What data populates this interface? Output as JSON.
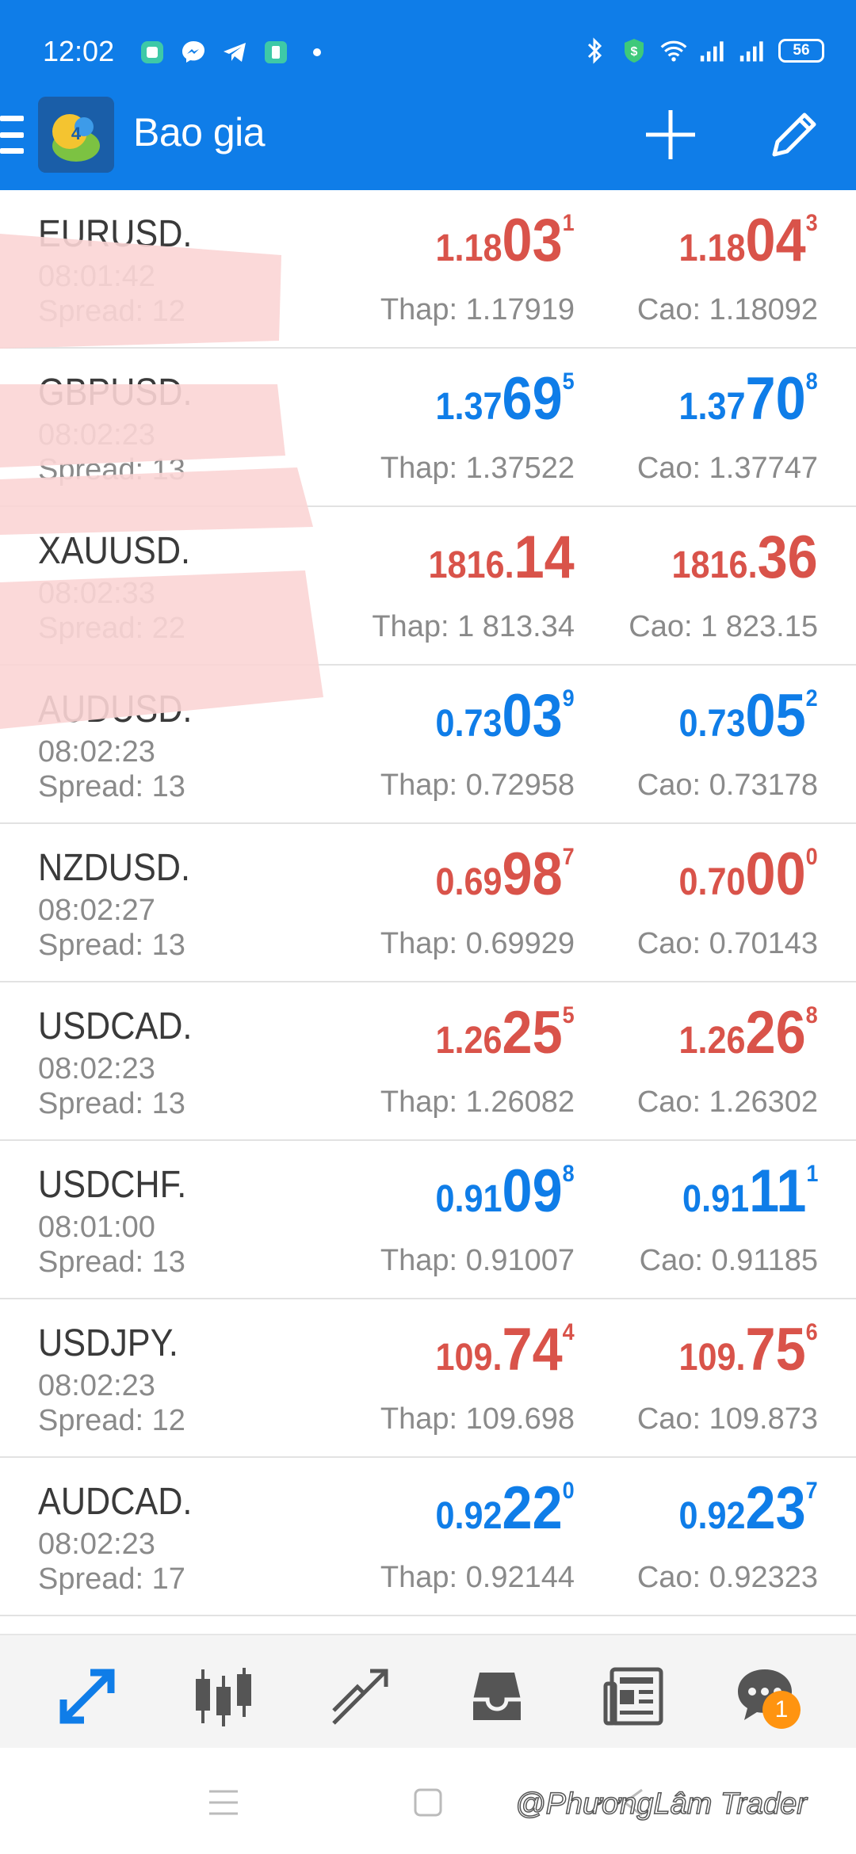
{
  "status_bar": {
    "time": "12:02",
    "battery": "56",
    "left_icons": [
      "app-icon",
      "messenger-icon",
      "telegram-icon",
      "sim-app-icon",
      "dot-icon"
    ],
    "right_icons": [
      "bluetooth-icon",
      "vpn-shield-icon",
      "wifi-icon",
      "signal-icon",
      "signal-icon",
      "battery-icon"
    ]
  },
  "app_bar": {
    "title": "Bao gia",
    "icons": [
      "menu-icon",
      "metatrader-logo",
      "add-icon",
      "edit-icon"
    ]
  },
  "quotes": [
    {
      "symbol": "EURUSD.",
      "time": "08:01:42",
      "spread": "Spread: 12",
      "bid": {
        "small": "1.18",
        "big": "03",
        "sup": "1",
        "color": "#d9534a"
      },
      "ask": {
        "small": "1.18",
        "big": "04",
        "sup": "3",
        "color": "#d9534a"
      },
      "low": "Thap: 1.17919",
      "high": "Cao: 1.18092"
    },
    {
      "symbol": "GBPUSD.",
      "time": "08:02:23",
      "spread": "Spread: 13",
      "bid": {
        "small": "1.37",
        "big": "69",
        "sup": "5",
        "color": "#0f7de8"
      },
      "ask": {
        "small": "1.37",
        "big": "70",
        "sup": "8",
        "color": "#0f7de8"
      },
      "low": "Thap: 1.37522",
      "high": "Cao: 1.37747"
    },
    {
      "symbol": "XAUUSD.",
      "time": "08:02:33",
      "spread": "Spread: 22",
      "bid": {
        "small": "1816.",
        "big": "14",
        "sup": "",
        "color": "#d9534a"
      },
      "ask": {
        "small": "1816.",
        "big": "36",
        "sup": "",
        "color": "#d9534a"
      },
      "low": "Thap: 1 813.34",
      "high": "Cao: 1 823.15"
    },
    {
      "symbol": "AUDUSD.",
      "time": "08:02:23",
      "spread": "Spread: 13",
      "bid": {
        "small": "0.73",
        "big": "03",
        "sup": "9",
        "color": "#0f7de8"
      },
      "ask": {
        "small": "0.73",
        "big": "05",
        "sup": "2",
        "color": "#0f7de8"
      },
      "low": "Thap: 0.72958",
      "high": "Cao: 0.73178"
    },
    {
      "symbol": "NZDUSD.",
      "time": "08:02:27",
      "spread": "Spread: 13",
      "bid": {
        "small": "0.69",
        "big": "98",
        "sup": "7",
        "color": "#d9534a"
      },
      "ask": {
        "small": "0.70",
        "big": "00",
        "sup": "0",
        "color": "#d9534a"
      },
      "low": "Thap: 0.69929",
      "high": "Cao: 0.70143"
    },
    {
      "symbol": "USDCAD.",
      "time": "08:02:23",
      "spread": "Spread: 13",
      "bid": {
        "small": "1.26",
        "big": "25",
        "sup": "5",
        "color": "#d9534a"
      },
      "ask": {
        "small": "1.26",
        "big": "26",
        "sup": "8",
        "color": "#d9534a"
      },
      "low": "Thap: 1.26082",
      "high": "Cao: 1.26302"
    },
    {
      "symbol": "USDCHF.",
      "time": "08:01:00",
      "spread": "Spread: 13",
      "bid": {
        "small": "0.91",
        "big": "09",
        "sup": "8",
        "color": "#0f7de8"
      },
      "ask": {
        "small": "0.91",
        "big": "11",
        "sup": "1",
        "color": "#0f7de8"
      },
      "low": "Thap: 0.91007",
      "high": "Cao: 0.91185"
    },
    {
      "symbol": "USDJPY.",
      "time": "08:02:23",
      "spread": "Spread: 12",
      "bid": {
        "small": "109.",
        "big": "74",
        "sup": "4",
        "color": "#d9534a"
      },
      "ask": {
        "small": "109.",
        "big": "75",
        "sup": "6",
        "color": "#d9534a"
      },
      "low": "Thap: 109.698",
      "high": "Cao: 109.873"
    },
    {
      "symbol": "AUDCAD.",
      "time": "08:02:23",
      "spread": "Spread: 17",
      "bid": {
        "small": "0.92",
        "big": "22",
        "sup": "0",
        "color": "#0f7de8"
      },
      "ask": {
        "small": "0.92",
        "big": "23",
        "sup": "7",
        "color": "#0f7de8"
      },
      "low": "Thap: 0.92144",
      "high": "Cao: 0.92323"
    }
  ],
  "bottom_nav": {
    "items": [
      "quotes-icon",
      "chart-icon",
      "trade-icon",
      "history-icon",
      "news-icon",
      "chat-icon"
    ],
    "chat_badge": "1"
  },
  "watermark": "@PhươngLâm Trader",
  "colors": {
    "accent": "#0f7de8",
    "down": "#d9534a",
    "up": "#0f7de8",
    "badge": "#ff9410"
  }
}
